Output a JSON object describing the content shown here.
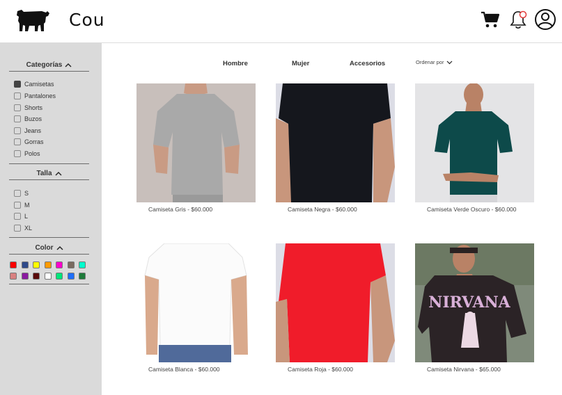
{
  "header": {
    "brand": "Cou",
    "icons": [
      "cow-logo-icon",
      "cart-icon",
      "bell-icon",
      "user-icon"
    ]
  },
  "sidebar": {
    "categories_title": "Categorías",
    "categories": [
      {
        "label": "Camisetas",
        "checked": true
      },
      {
        "label": "Pantalones",
        "checked": false
      },
      {
        "label": "Shorts",
        "checked": false
      },
      {
        "label": "Buzos",
        "checked": false
      },
      {
        "label": "Jeans",
        "checked": false
      },
      {
        "label": "Gorras",
        "checked": false
      },
      {
        "label": "Polos",
        "checked": false
      }
    ],
    "size_title": "Talla",
    "sizes": [
      {
        "label": "S",
        "checked": false
      },
      {
        "label": "M",
        "checked": false
      },
      {
        "label": "L",
        "checked": false
      },
      {
        "label": "XL",
        "checked": false
      }
    ],
    "color_title": "Color",
    "colors_row1": [
      "#ff0000",
      "#2e4a8a",
      "#ffff00",
      "#ff9900",
      "#ff00cc",
      "#7a6a60",
      "#00ffcc"
    ],
    "colors_row2": [
      "#d88080",
      "#8a1aa0",
      "#5a0a0a",
      "#ffffff",
      "#00e67a",
      "#1e6fff",
      "#1e7a3a"
    ]
  },
  "nav": {
    "tabs": [
      "Hombre",
      "Mujer",
      "Accesorios"
    ],
    "sort_label": "Ordenar por"
  },
  "products": [
    {
      "caption": "Camiseta Gris - $60.000",
      "shirt": "#a9a9a9",
      "bg": "#c8bfbb"
    },
    {
      "caption": "Camiseta Negra - $60.000",
      "shirt": "#15171d",
      "bg": "#dcdde6"
    },
    {
      "caption": "Camiseta Verde Oscuro - $60.000",
      "shirt": "#0d4a4a",
      "bg": "#e4e4e6"
    },
    {
      "caption": "Camiseta Blanca - $60.000",
      "shirt": "#fbfbfb",
      "bg": "#ffffff"
    },
    {
      "caption": "Camiseta Roja - $60.000",
      "shirt": "#f01c2a",
      "bg": "#dcdde6"
    },
    {
      "caption": "Camiseta Nirvana - $65.000",
      "shirt": "#2b2326",
      "bg": "#7f8a7a",
      "print_text": "NIRVANA"
    }
  ]
}
